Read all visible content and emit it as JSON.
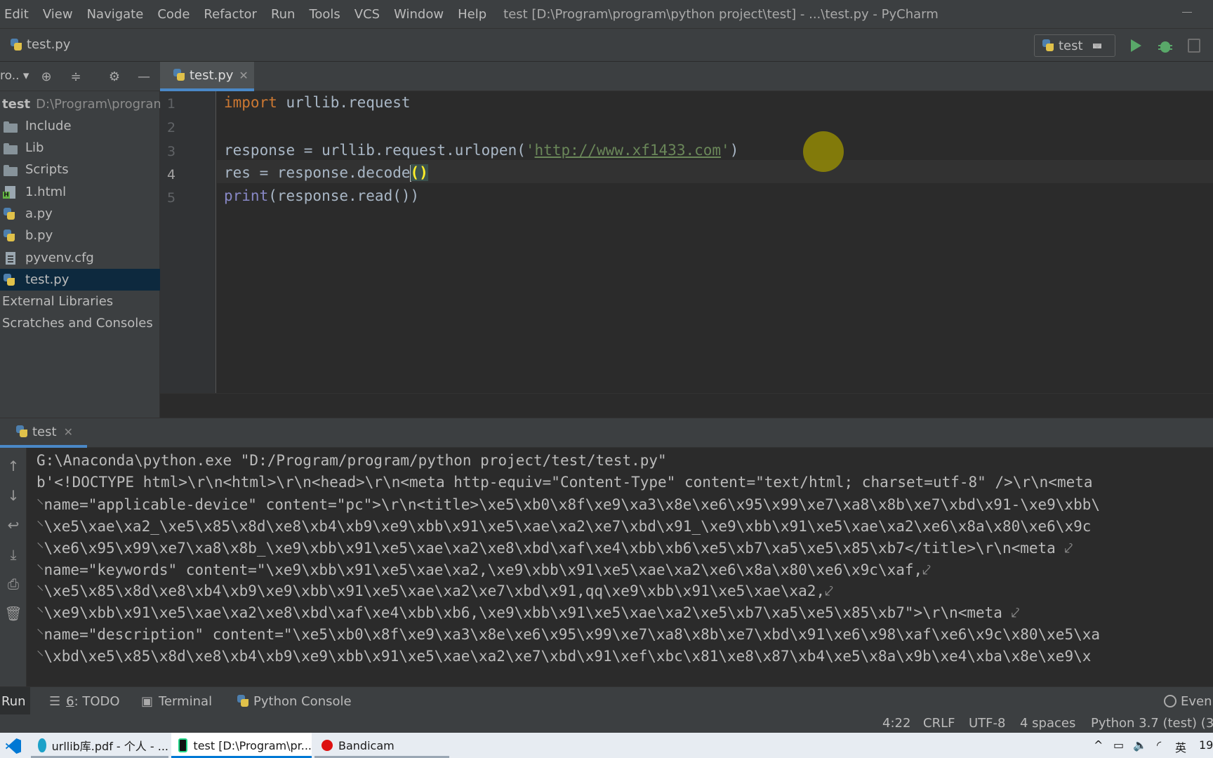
{
  "menubar": {
    "items": [
      "Edit",
      "View",
      "Navigate",
      "Code",
      "Refactor",
      "Run",
      "Tools",
      "VCS",
      "Window",
      "Help"
    ],
    "window_title": "test [D:\\Program\\program\\python project\\test] - ...\\test.py - PyCharm"
  },
  "navbar": {
    "file": "test.py",
    "run_config": "test"
  },
  "project_panel": {
    "selector": "ro..",
    "tree": [
      {
        "label": "test",
        "path": "D:\\Program\\program",
        "icon": "none"
      },
      {
        "label": "Include",
        "icon": "folder-icon"
      },
      {
        "label": "Lib",
        "icon": "folder-icon"
      },
      {
        "label": "Scripts",
        "icon": "folder-icon"
      },
      {
        "label": "1.html",
        "icon": "html-file-icon"
      },
      {
        "label": "a.py",
        "icon": "python-file-icon"
      },
      {
        "label": "b.py",
        "icon": "python-file-icon"
      },
      {
        "label": "pyvenv.cfg",
        "icon": "config-file-icon"
      },
      {
        "label": "test.py",
        "icon": "python-file-icon",
        "selected": true
      },
      {
        "label": "External Libraries",
        "icon": "none"
      },
      {
        "label": "Scratches and Consoles",
        "icon": "none"
      }
    ]
  },
  "editor": {
    "tab": "test.py",
    "line_numbers": [
      "1",
      "2",
      "3",
      "4",
      "5"
    ],
    "current_line": "4",
    "code": {
      "l1_kw": "import",
      "l1_rest": " urllib.request",
      "l3_pre": "response = urllib.request.urlopen(",
      "l3_q1": "'",
      "l3_url": "http://www.xf1433.com",
      "l3_q2": "'",
      "l3_post": ")",
      "l4_pre": "res = response.decode",
      "l4_parens": "()",
      "l5_fn": "print",
      "l5_rest": "(response.read())"
    }
  },
  "run_panel": {
    "tab": "test",
    "output": [
      "G:\\Anaconda\\python.exe \"D:/Program/program/python project/test/test.py\"",
      "b'<!DOCTYPE html>\\r\\n<html>\\r\\n<head>\\r\\n<meta http-equiv=\"Content-Type\" content=\"text/html; charset=utf-8\" />\\r\\n<meta",
      "name=\"applicable-device\" content=\"pc\">\\r\\n<title>\\xe5\\xb0\\x8f\\xe9\\xa3\\x8e\\xe6\\x95\\x99\\xe7\\xa8\\x8b\\xe7\\xbd\\x91-\\xe9\\xbb\\",
      "\\xe5\\xae\\xa2_\\xe5\\x85\\x8d\\xe8\\xb4\\xb9\\xe9\\xbb\\x91\\xe5\\xae\\xa2\\xe7\\xbd\\x91_\\xe9\\xbb\\x91\\xe5\\xae\\xa2\\xe6\\x8a\\x80\\xe6\\x9c",
      "\\xe6\\x95\\x99\\xe7\\xa8\\x8b_\\xe9\\xbb\\x91\\xe5\\xae\\xa2\\xe8\\xbd\\xaf\\xe4\\xbb\\xb6\\xe5\\xb7\\xa5\\xe5\\x85\\xb7</title>\\r\\n<meta",
      "name=\"keywords\" content=\"\\xe9\\xbb\\x91\\xe5\\xae\\xa2,\\xe9\\xbb\\x91\\xe5\\xae\\xa2\\xe6\\x8a\\x80\\xe6\\x9c\\xaf,",
      "\\xe5\\x85\\x8d\\xe8\\xb4\\xb9\\xe9\\xbb\\x91\\xe5\\xae\\xa2\\xe7\\xbd\\x91,qq\\xe9\\xbb\\x91\\xe5\\xae\\xa2,",
      "\\xe9\\xbb\\x91\\xe5\\xae\\xa2\\xe8\\xbd\\xaf\\xe4\\xbb\\xb6,\\xe9\\xbb\\x91\\xe5\\xae\\xa2\\xe5\\xb7\\xa5\\xe5\\x85\\xb7\">\\r\\n<meta",
      "name=\"description\" content=\"\\xe5\\xb0\\x8f\\xe9\\xa3\\x8e\\xe6\\x95\\x99\\xe7\\xa8\\x8b\\xe7\\xbd\\x91\\xe6\\x98\\xaf\\xe6\\x9c\\x80\\xe5\\xa",
      "\\xbd\\xe5\\x85\\x8d\\xe8\\xb4\\xb9\\xe9\\xbb\\x91\\xe5\\xae\\xa2\\xe7\\xbd\\x91\\xef\\xbc\\x81\\xe8\\x87\\xb4\\xe5\\x8a\\x9b\\xe4\\xba\\x8e\\xe9\\x"
    ]
  },
  "tool_stripe": {
    "run": "Run",
    "todo_num": "6",
    "todo": ": TODO",
    "terminal": "Terminal",
    "python_console": "Python Console",
    "event_log": "Even"
  },
  "statusbar": {
    "position": "4:22",
    "line_sep": "CRLF",
    "encoding": "UTF-8",
    "indent": "4 spaces",
    "interpreter": "Python 3.7 (test) (3"
  },
  "taskbar": {
    "apps": [
      "urllib库.pdf - 个人 - ...",
      "test [D:\\Program\\pr...",
      "Bandicam"
    ],
    "ime": "英",
    "clock": "19"
  },
  "colors": {
    "accent": "#4a88c7",
    "keyword": "#cc7832",
    "string": "#6a8759",
    "builtin": "#8888c6",
    "run_green": "#59a869"
  }
}
